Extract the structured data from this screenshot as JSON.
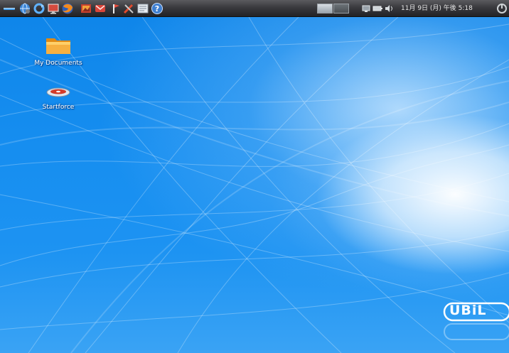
{
  "panel": {
    "launchers": [
      {
        "icon": "applications-menu-icon"
      },
      {
        "icon": "network-globe-icon"
      },
      {
        "icon": "refresh-sync-icon"
      },
      {
        "icon": "monitor-icon"
      },
      {
        "icon": "firefox-browser-icon"
      },
      {
        "icon": "image-viewer-icon"
      },
      {
        "icon": "mail-icon"
      },
      {
        "icon": "bookmark-flag-icon"
      },
      {
        "icon": "tools-icon"
      },
      {
        "icon": "text-editor-icon"
      },
      {
        "icon": "help-icon"
      }
    ],
    "workspaces": [
      {
        "name": "workspace-1",
        "active": true
      },
      {
        "name": "workspace-2",
        "active": false
      }
    ],
    "tray_icons": [
      "network-icon",
      "battery-icon",
      "volume-icon"
    ],
    "clock": "11月 9日 (月) 午後 5:18",
    "power_icon": "power-icon"
  },
  "desktop": {
    "icons": [
      {
        "label": "My Documents",
        "icon": "folder-icon"
      },
      {
        "label": "Startforce",
        "icon": "startforce-disc-icon"
      }
    ],
    "brand_logo": "UBiL"
  },
  "colors": {
    "panel": "#3a3a3e",
    "wallpaper": "#1a8ef0",
    "folder": "#f3a830"
  }
}
